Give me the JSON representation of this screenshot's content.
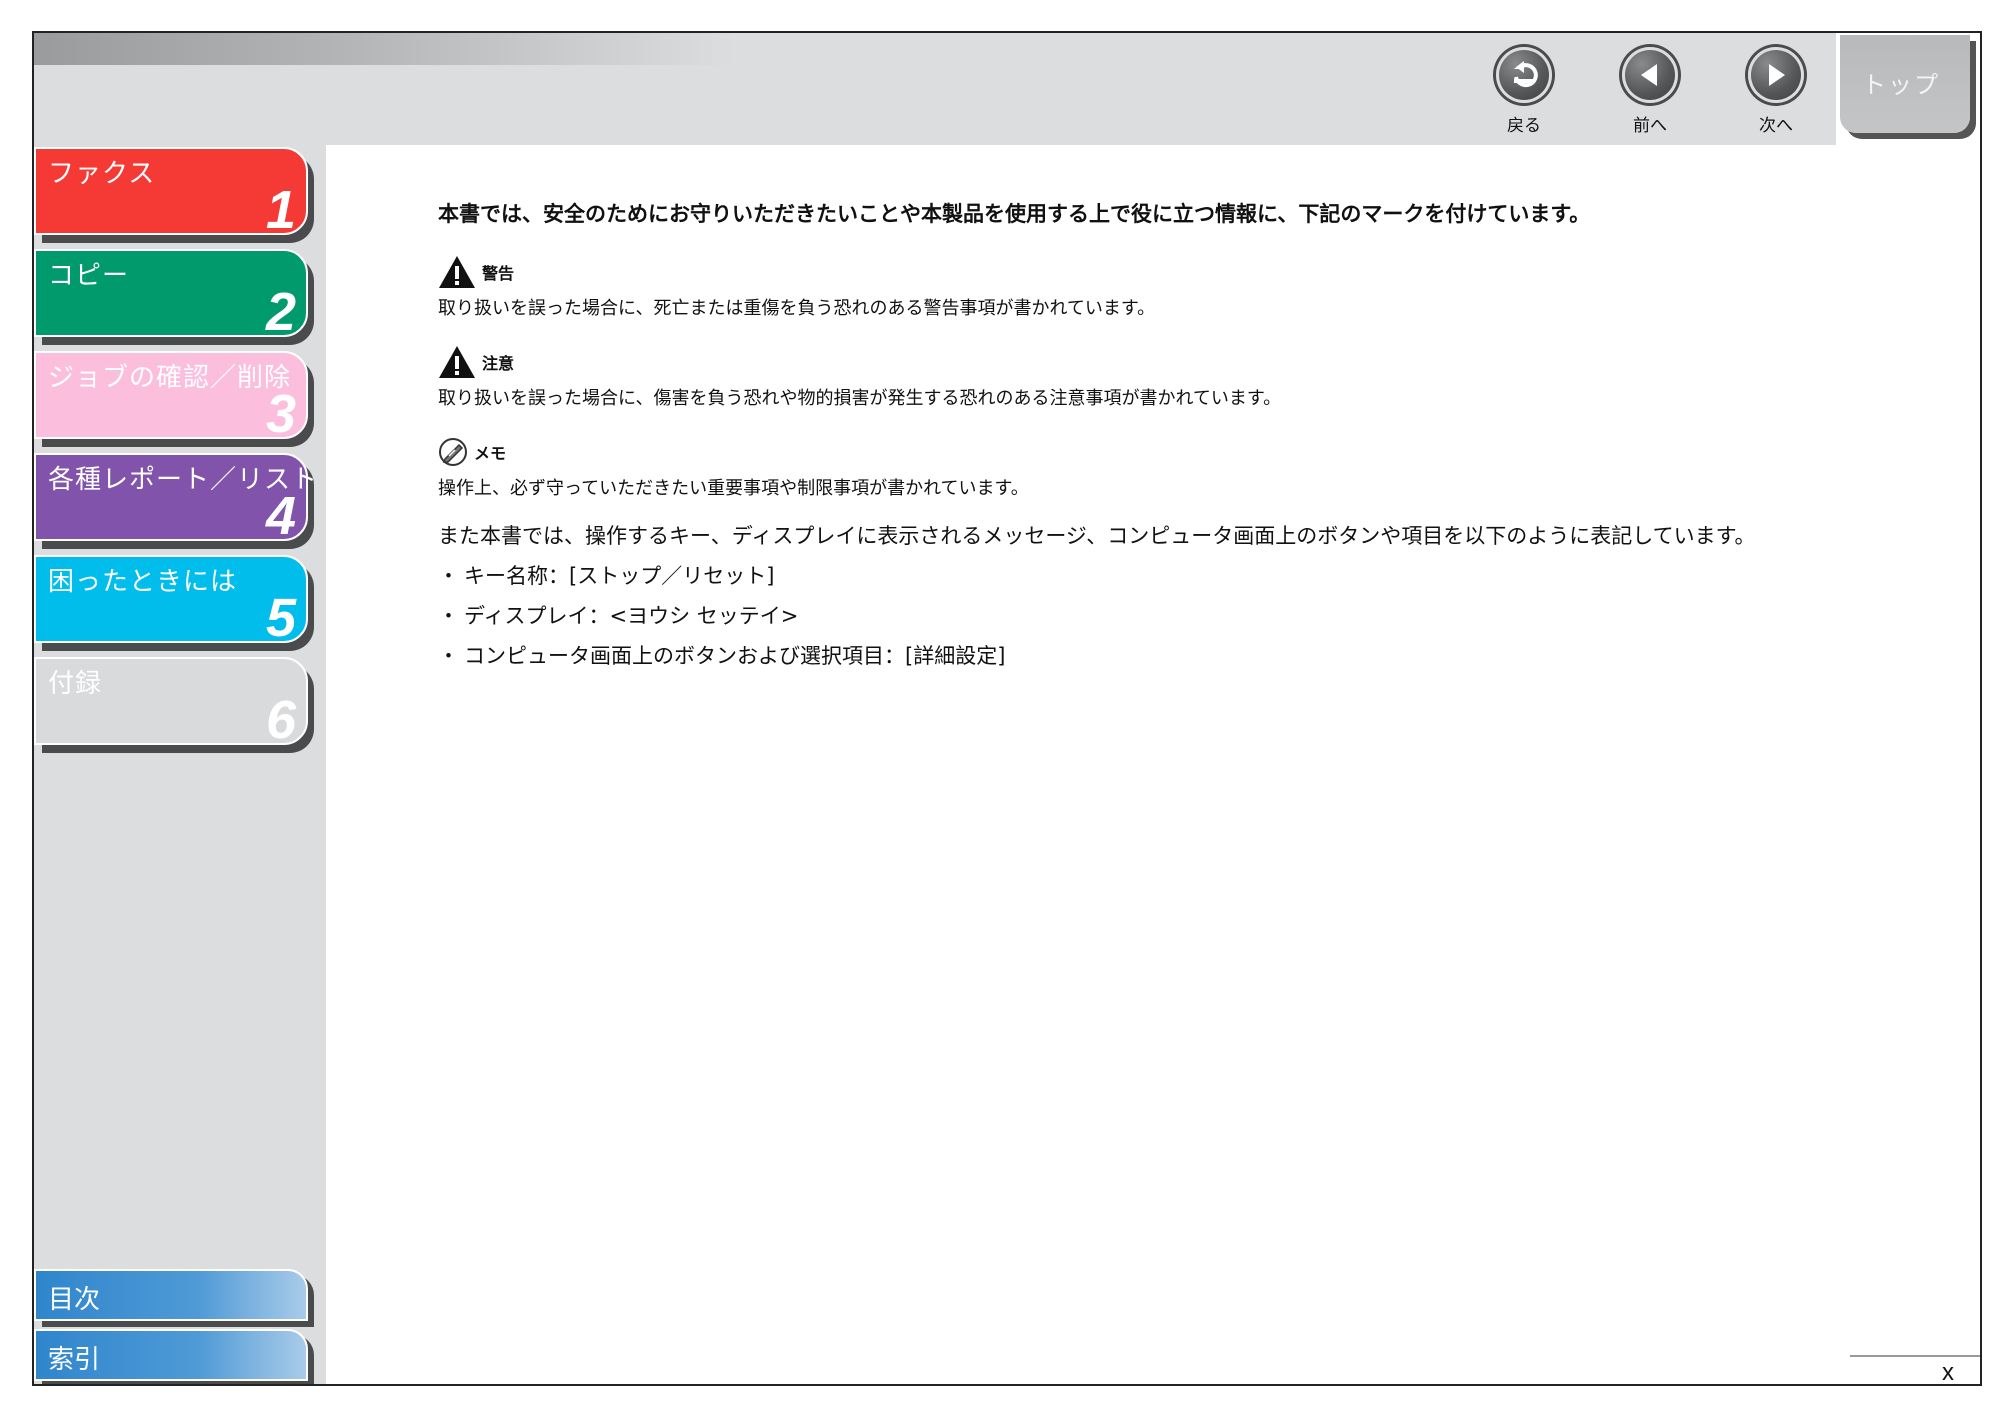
{
  "nav": {
    "back_label": "戻る",
    "prev_label": "前へ",
    "next_label": "次へ",
    "top_label": "トップ"
  },
  "sidebar": {
    "tabs": [
      {
        "title": "ファクス",
        "number": "1",
        "color": "#f53a36"
      },
      {
        "title": "コピー",
        "number": "2",
        "color": "#009a6c"
      },
      {
        "title": "ジョブの確認／削除",
        "number": "3",
        "color": "#fbbfdd"
      },
      {
        "title": "各種レポート／リスト",
        "number": "4",
        "color": "#8153aa"
      },
      {
        "title": "困ったときには",
        "number": "5",
        "color": "#00bdec"
      },
      {
        "title": "付録",
        "number": "6",
        "color": "#d9dadc"
      }
    ],
    "toc_label": "目次",
    "index_label": "索引"
  },
  "content": {
    "intro": "本書では、安全のためにお守りいただきたいことや本製品を使用する上で役に立つ情報に、下記のマークを付けています。",
    "marks": [
      {
        "icon": "warning-icon",
        "title": "警告",
        "description": "取り扱いを誤った場合に、死亡または重傷を負う恐れのある警告事項が書かれています。"
      },
      {
        "icon": "caution-icon",
        "title": "注意",
        "description": "取り扱いを誤った場合に、傷害を負う恐れや物的損害が発生する恐れのある注意事項が書かれています。"
      },
      {
        "icon": "memo-icon",
        "title": "メモ",
        "description": "操作上、必ず守っていただきたい重要事項や制限事項が書かれています。"
      }
    ],
    "notation_intro": "また本書では、操作するキー、ディスプレイに表示されるメッセージ、コンピュータ画面上のボタンや項目を以下のように表記しています。",
    "bullets": [
      "キー名称：[ストップ／リセット]",
      "ディスプレイ：<ヨウシ セッテイ>",
      "コンピュータ画面上のボタンおよび選択項目：[詳細設定]"
    ]
  },
  "page_number": "x"
}
